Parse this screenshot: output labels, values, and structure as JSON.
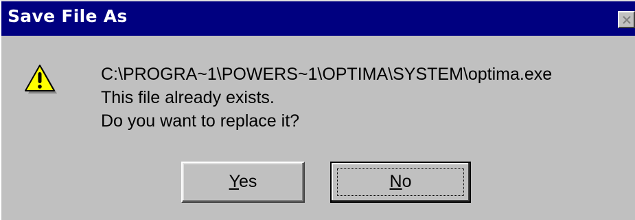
{
  "window": {
    "title": "Save File As"
  },
  "icons": {
    "warning": "warning-icon",
    "close": "close-icon"
  },
  "message": {
    "path": "C:\\PROGRA~1\\POWERS~1\\OPTIMA\\SYSTEM\\optima.exe",
    "line1": "This file already exists.",
    "line2": "Do you want to replace it?"
  },
  "buttons": {
    "yes": {
      "accel": "Y",
      "rest": "es"
    },
    "no": {
      "accel": "N",
      "rest": "o"
    }
  },
  "colors": {
    "titlebar": "#000080",
    "face": "#c0c0c0",
    "warning_fill": "#ffff00"
  }
}
